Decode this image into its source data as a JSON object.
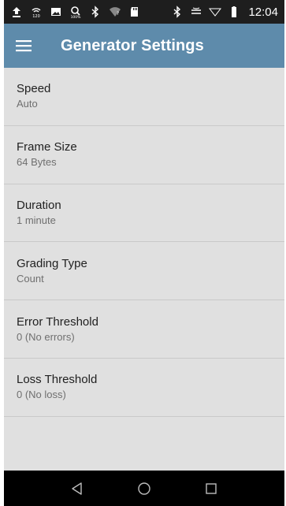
{
  "status_bar": {
    "time": "12:04",
    "icons": [
      "upload-icon",
      "signal-icon",
      "image-icon",
      "search-icon",
      "bluetooth-icon",
      "wifi-icon",
      "sd-card-icon",
      "bluetooth-icon",
      "vibrate-icon",
      "signal-icon",
      "battery-icon"
    ],
    "percent": "100%"
  },
  "app_bar": {
    "title": "Generator Settings",
    "menu_icon": "menu-icon"
  },
  "settings": [
    {
      "title": "Speed",
      "value": "Auto"
    },
    {
      "title": "Frame Size",
      "value": "64 Bytes"
    },
    {
      "title": "Duration",
      "value": "1 minute"
    },
    {
      "title": "Grading Type",
      "value": "Count"
    },
    {
      "title": "Error Threshold",
      "value": "0 (No errors)"
    },
    {
      "title": "Loss Threshold",
      "value": "0 (No loss)"
    }
  ],
  "nav_bar": {
    "back_icon": "back-icon",
    "home_icon": "home-icon",
    "recents_icon": "recents-icon"
  },
  "colors": {
    "app_bar": "#5e8bab",
    "background": "#e0e0e0",
    "status_bar": "#1e1e1e",
    "nav_bar": "#000000"
  }
}
